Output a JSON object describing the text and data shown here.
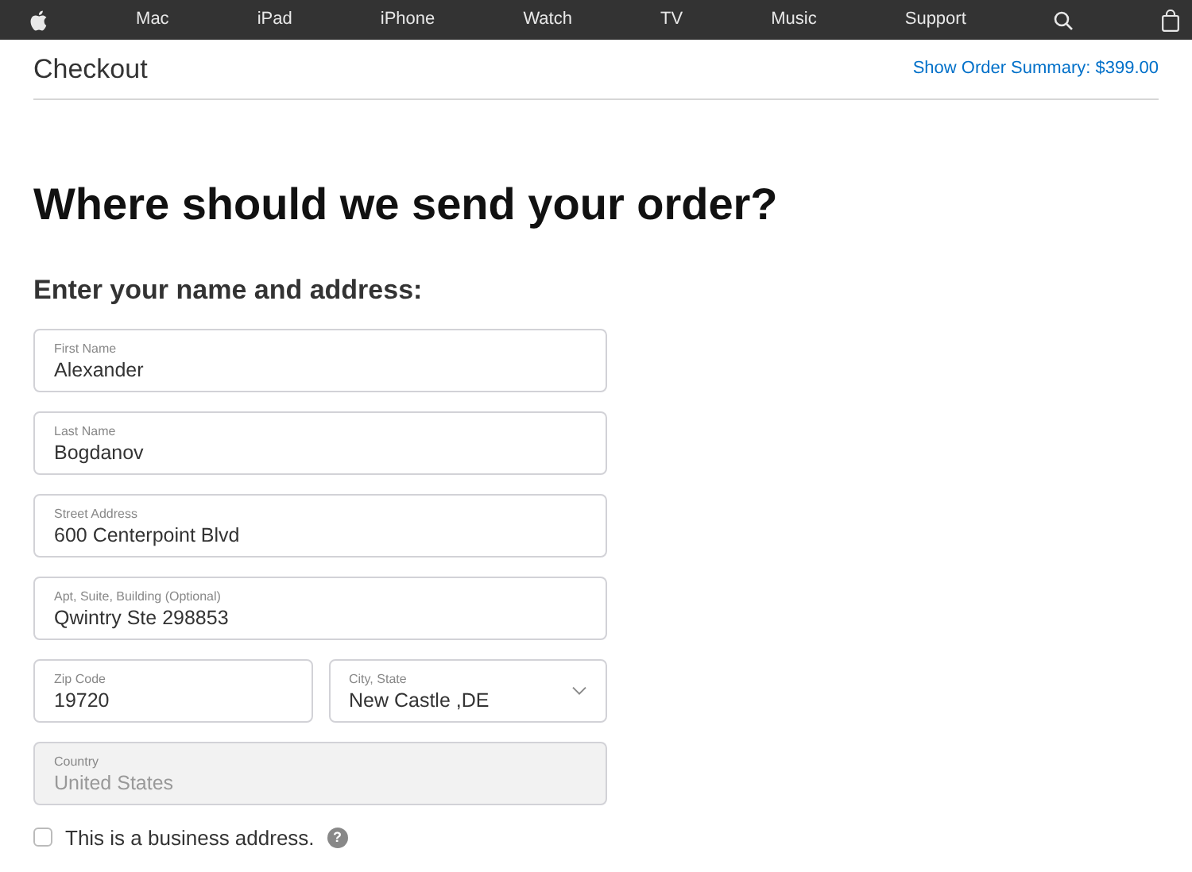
{
  "nav": {
    "items": [
      "Mac",
      "iPad",
      "iPhone",
      "Watch",
      "TV",
      "Music",
      "Support"
    ]
  },
  "header": {
    "title": "Checkout",
    "summary_link": "Show Order Summary: $399.00"
  },
  "heading": "Where should we send your order?",
  "subheading": "Enter your name and address:",
  "field_rows": [
    [
      {
        "kind": "text",
        "label": "First Name",
        "value": "Alexander"
      }
    ],
    [
      {
        "kind": "text",
        "label": "Last Name",
        "value": "Bogdanov"
      }
    ],
    [
      {
        "kind": "text",
        "label": "Street Address",
        "value": "600 Centerpoint Blvd"
      }
    ],
    [
      {
        "kind": "text",
        "label": "Apt, Suite, Building (Optional)",
        "value": "Qwintry Ste 298853"
      }
    ],
    [
      {
        "kind": "text",
        "label": "Zip Code",
        "value": "19720"
      },
      {
        "kind": "select",
        "label": "City, State",
        "value": "New Castle ,DE"
      }
    ],
    [
      {
        "kind": "disabled",
        "label": "Country",
        "value": "United States"
      }
    ]
  ],
  "business_checkbox": {
    "label": "This is a business address.",
    "checked": false,
    "help": "?"
  }
}
